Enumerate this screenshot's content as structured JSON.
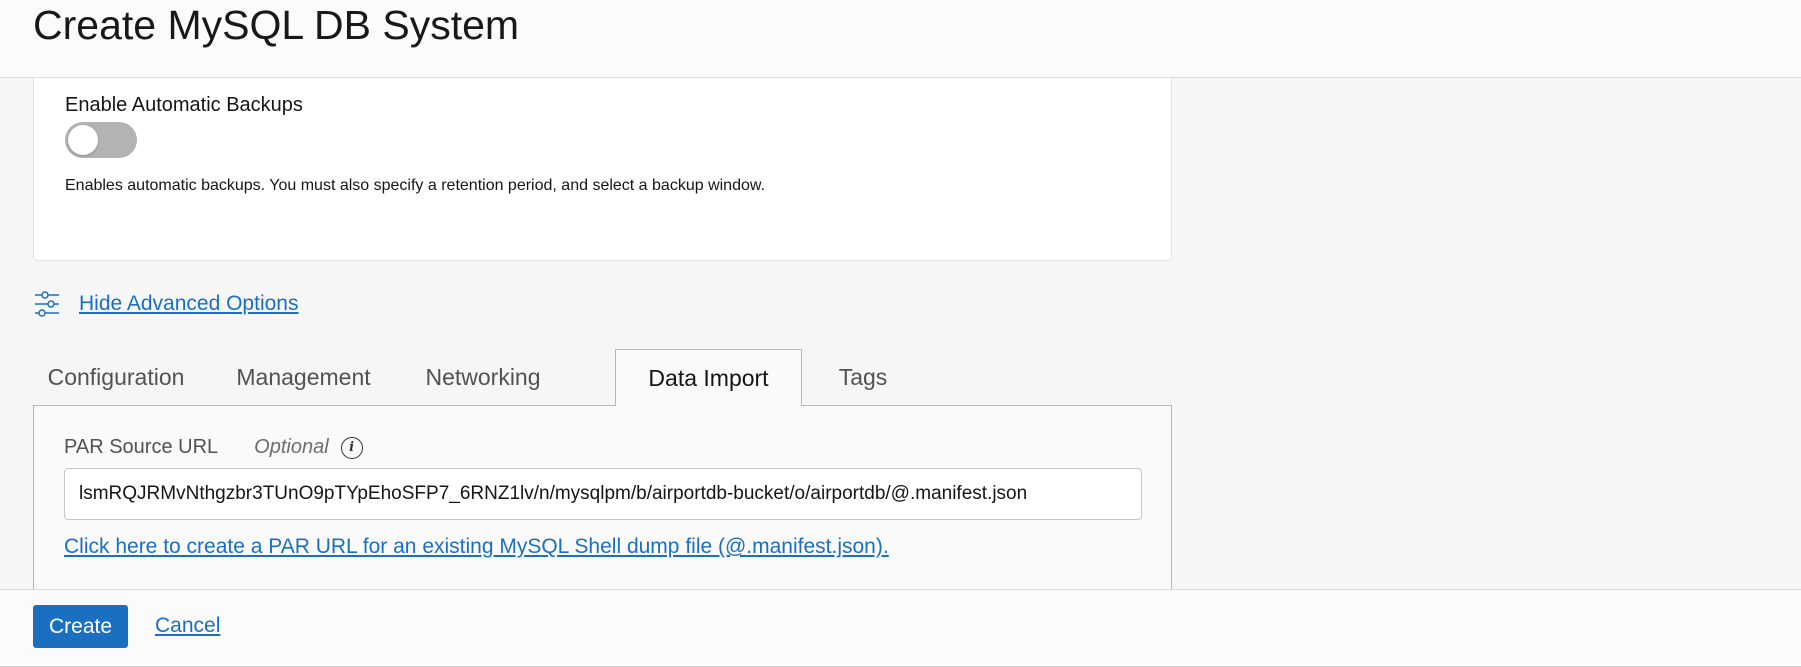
{
  "header": {
    "title": "Create MySQL DB System"
  },
  "backups": {
    "toggle_label": "Enable Automatic Backups",
    "toggle_on": false,
    "help_text": "Enables automatic backups. You must also specify a retention period, and select a backup window."
  },
  "advanced": {
    "icon": "sliders-icon",
    "link_label": "Hide Advanced Options"
  },
  "tabs": [
    {
      "label": "Configuration",
      "active": false
    },
    {
      "label": "Management",
      "active": false
    },
    {
      "label": "Networking",
      "active": false
    },
    {
      "label": "Data Import",
      "active": true
    },
    {
      "label": "Tags",
      "active": false
    }
  ],
  "data_import": {
    "par_label": "PAR Source URL",
    "par_optional": "Optional",
    "par_value": "lsmRQJRMvNthgzbr3TUnO9pTYpEhoSFP7_6RNZ1lv/n/mysqlpm/b/airportdb-bucket/o/airportdb/@.manifest.json",
    "create_par_link": "Click here to create a PAR URL for an existing MySQL Shell dump file (@.manifest.json)."
  },
  "footer": {
    "create_label": "Create",
    "cancel_label": "Cancel"
  },
  "colors": {
    "primary": "#1b6fc1",
    "link": "#1a6fc4",
    "toggle_off": "#b3b3b3"
  }
}
